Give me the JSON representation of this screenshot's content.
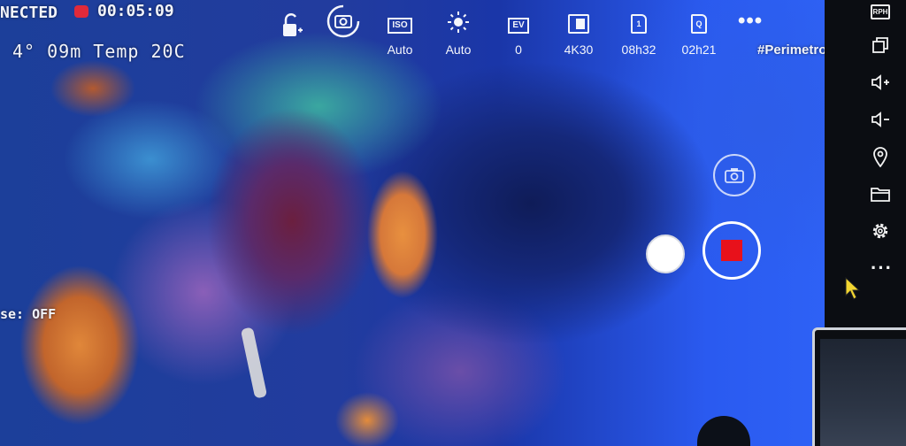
{
  "hud": {
    "connection_status": "NECTED",
    "recording_time": "00:05:09",
    "depth_temp": "4° 09m Temp 20C",
    "pulse_status": "se: OFF",
    "watermark": "#Perimetros"
  },
  "settings": {
    "iso_label": "ISO",
    "iso_value": "Auto",
    "exposure_value": "Auto",
    "ev_label": "EV",
    "ev_value": "0",
    "resolution_value": "4K30",
    "storage_card_label": "1",
    "storage_time_value": "08h32",
    "q_card_label": "Q",
    "q_time_value": "02h21"
  },
  "sidebar": {
    "top_label": "RPH"
  },
  "colors": {
    "record_red": "#e8111b",
    "rec_dot": "#e02a3a",
    "toolbar_bg": "#0b0d12",
    "water_blue": "#2e62f6"
  },
  "icons": {
    "lock": "lock-icon",
    "auto_rotate": "auto-rotate-icon",
    "brightness": "brightness-icon",
    "resolution": "resolution-icon",
    "sd_card": "sd-card-icon",
    "switch_camera": "switch-camera-icon",
    "volume_up": "volume-up-icon",
    "volume_down": "volume-down-icon",
    "location": "location-icon",
    "folder": "folder-icon",
    "gear": "gear-icon",
    "more": "more-icon"
  }
}
